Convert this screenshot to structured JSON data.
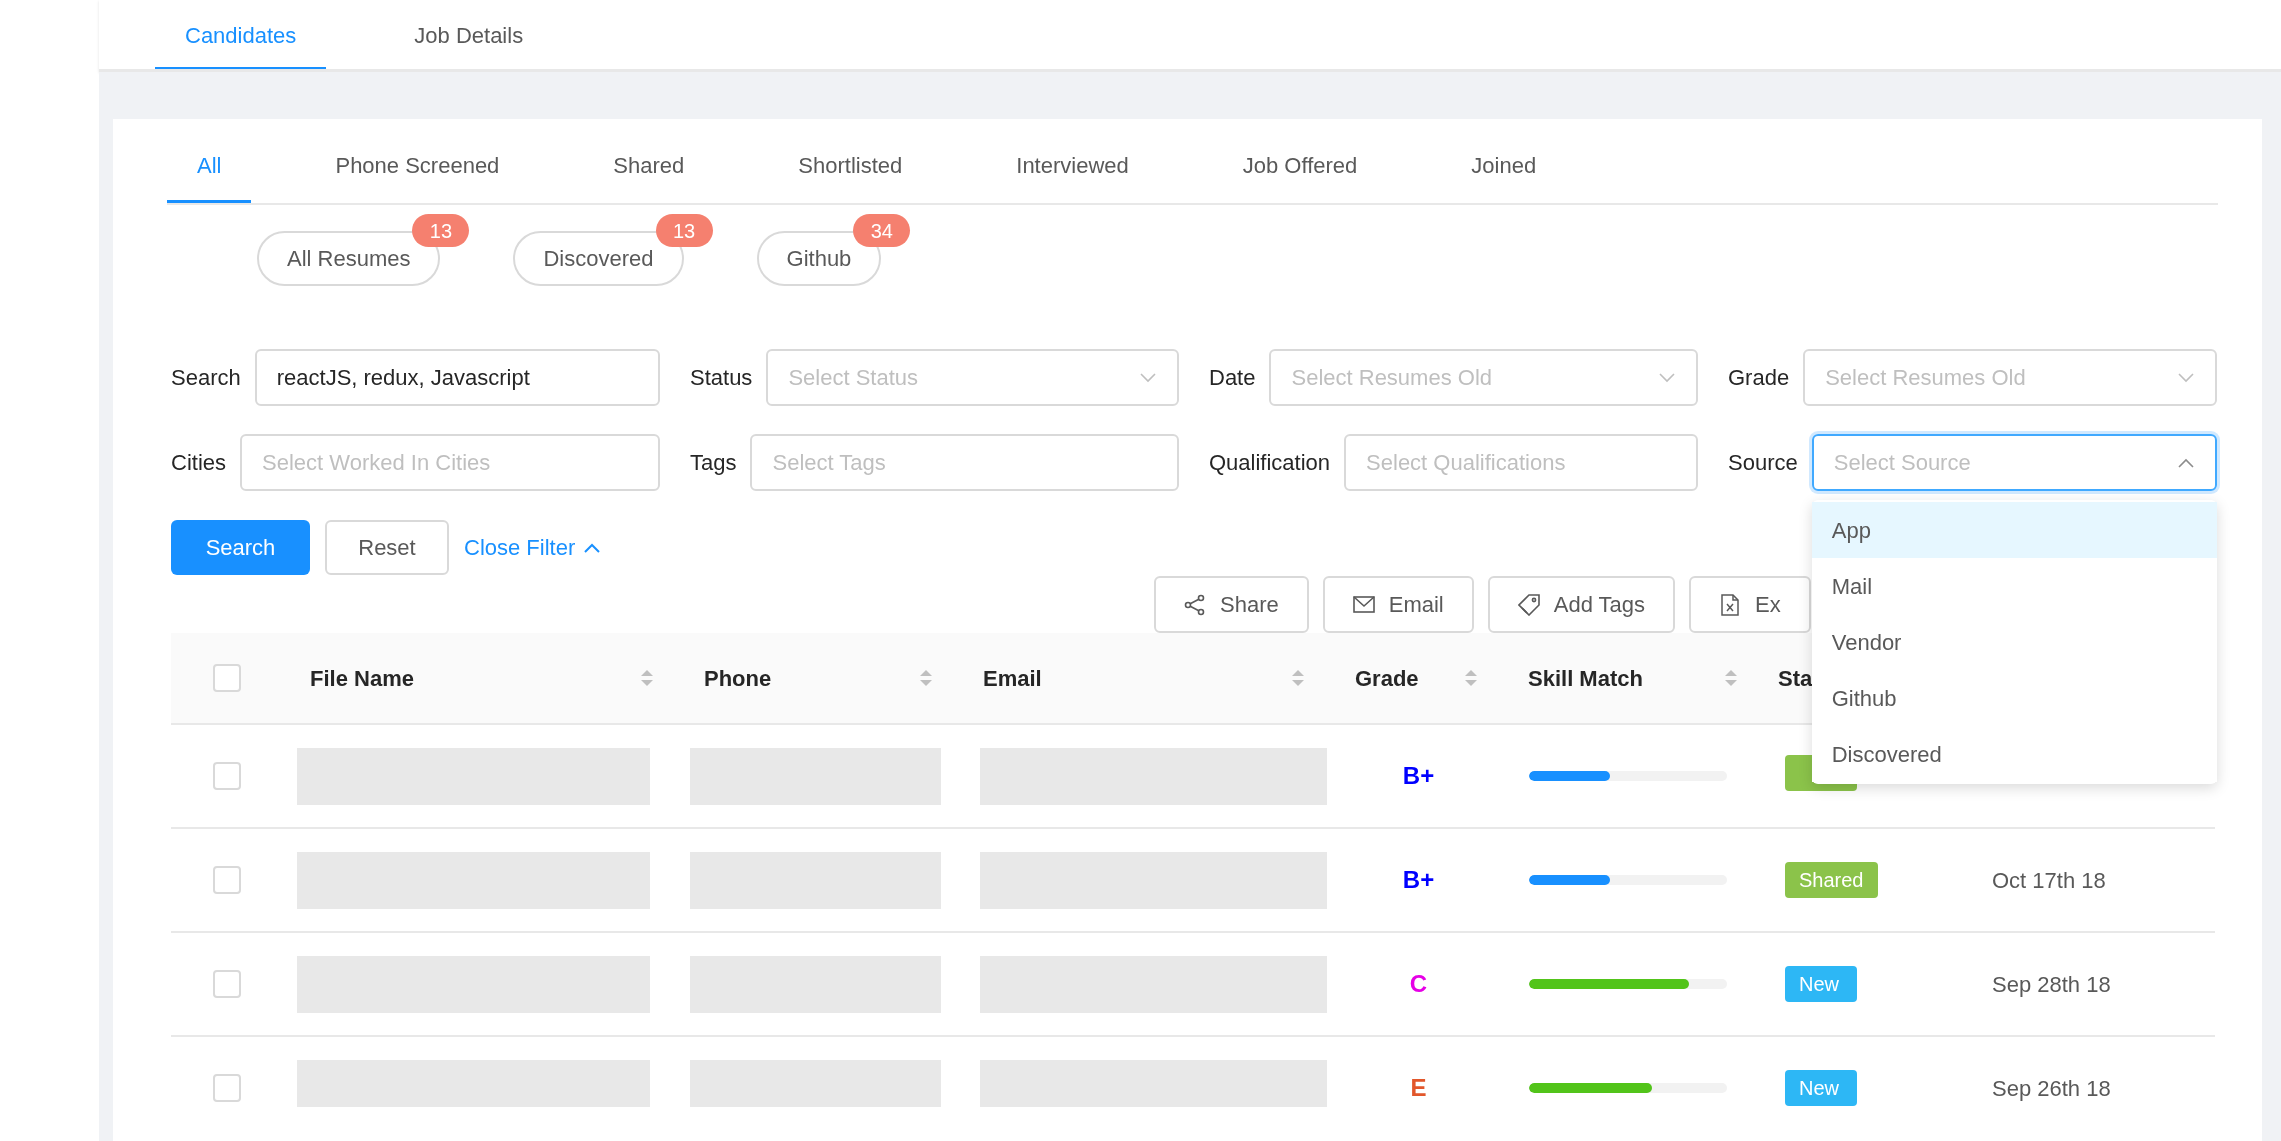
{
  "top_tabs": [
    {
      "label": "Candidates",
      "selected": true
    },
    {
      "label": "Job Details",
      "selected": false
    }
  ],
  "stage_tabs": [
    {
      "label": "All",
      "selected": true
    },
    {
      "label": "Phone Screened",
      "selected": false
    },
    {
      "label": "Shared",
      "selected": false
    },
    {
      "label": "Shortlisted",
      "selected": false
    },
    {
      "label": "Interviewed",
      "selected": false
    },
    {
      "label": "Job Offered",
      "selected": false
    },
    {
      "label": "Joined",
      "selected": false
    }
  ],
  "source_chips": [
    {
      "label": "All Resumes",
      "count": "13"
    },
    {
      "label": "Discovered",
      "count": "13"
    },
    {
      "label": "Github",
      "count": "34"
    }
  ],
  "filters": [
    {
      "label": "Search",
      "kind": "input",
      "value": "reactJS, redux, Javascript"
    },
    {
      "label": "Status",
      "kind": "select",
      "placeholder": "Select Status",
      "expanded": false
    },
    {
      "label": "Date",
      "kind": "select",
      "placeholder": "Select Resumes Old",
      "expanded": false
    },
    {
      "label": "Grade",
      "kind": "select",
      "placeholder": "Select Resumes Old",
      "expanded": false
    },
    {
      "label": "Cities",
      "kind": "input",
      "placeholder": "Select Worked In Cities"
    },
    {
      "label": "Tags",
      "kind": "input",
      "placeholder": "Select Tags"
    },
    {
      "label": "Qualification",
      "kind": "input",
      "placeholder": "Select Qualifications"
    },
    {
      "label": "Source",
      "kind": "select",
      "placeholder": "Select Source",
      "expanded": true,
      "options": [
        {
          "label": "App",
          "selected": true
        },
        {
          "label": "Mail",
          "selected": false
        },
        {
          "label": "Vendor",
          "selected": false
        },
        {
          "label": "Github",
          "selected": false
        },
        {
          "label": "Discovered",
          "selected": false
        }
      ]
    }
  ],
  "filter_buttons": {
    "search": "Search",
    "reset": "Reset",
    "close_filter": "Close Filter"
  },
  "actions": [
    {
      "label": "Share",
      "kind": "share"
    },
    {
      "label": "Email",
      "kind": "email"
    },
    {
      "label": "Add Tags",
      "kind": "tag"
    },
    {
      "label": "Ex",
      "kind": "excel"
    }
  ],
  "table": {
    "select_all_checked": false,
    "columns": [
      "File Name",
      "Phone",
      "Email",
      "Grade",
      "Skill Match",
      "Sta"
    ],
    "rows": [
      {
        "checked": false,
        "grade": "B+",
        "color": "#0000ff",
        "skill": {
          "level": 0.41,
          "color": "#1890ff"
        },
        "status": {
          "kind": "shared"
        }
      },
      {
        "checked": false,
        "grade": "B+",
        "color": "#0000ff",
        "skill": {
          "level": 0.41,
          "color": "#1890ff"
        },
        "status": {
          "label": "Shared",
          "kind": "shared"
        },
        "date": "Oct 17th 18"
      },
      {
        "checked": false,
        "grade": "C",
        "color": "#e600e6",
        "skill": {
          "level": 0.81,
          "color": "#52c41a"
        },
        "status": {
          "label": "New",
          "kind": "new"
        },
        "date": "Sep 28th 18"
      },
      {
        "checked": false,
        "grade": "E",
        "color": "#e2572b",
        "skill": {
          "level": 0.62,
          "color": "#52c41a"
        },
        "status": {
          "label": "New",
          "kind": "new"
        },
        "date": "Sep 26th 18"
      }
    ]
  }
}
